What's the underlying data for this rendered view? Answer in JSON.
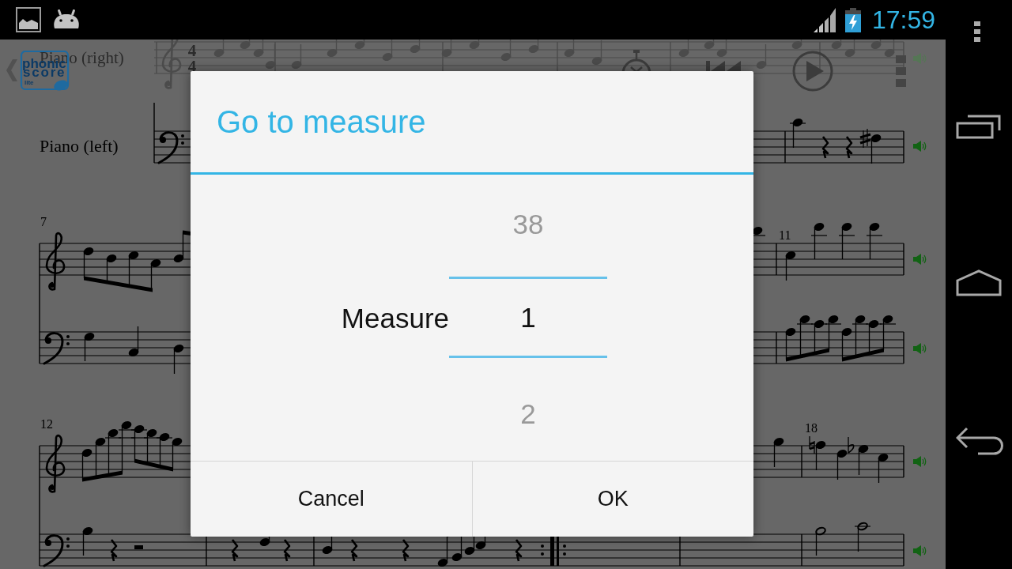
{
  "status_bar": {
    "time": "17:59"
  },
  "toolbar": {
    "logo": {
      "line_1": "phonic",
      "line_2": "score",
      "line_3": "lite"
    }
  },
  "score": {
    "systems": [
      {
        "time_signature": [
          "4",
          "4"
        ],
        "staff_labels": [
          "Piano (right)",
          "Piano (left)"
        ]
      },
      {
        "measure_numbers": [
          "7",
          "11"
        ]
      },
      {
        "measure_numbers": [
          "12",
          "18"
        ]
      }
    ]
  },
  "dialog": {
    "title": "Go to measure",
    "picker": {
      "label": "Measure",
      "previous": "38",
      "value": "1",
      "next": "2"
    },
    "buttons": [
      "Cancel",
      "OK"
    ]
  }
}
